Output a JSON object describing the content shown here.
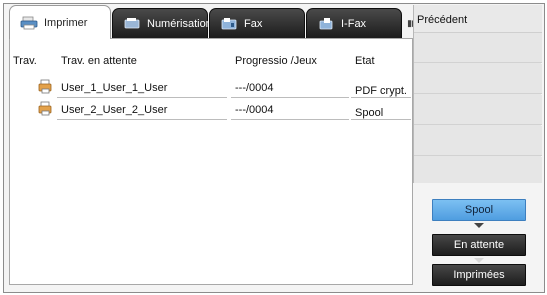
{
  "tabs": [
    {
      "label": "Imprimer",
      "icon": "printer-icon"
    },
    {
      "label": "Numérisation",
      "icon": "scanner-icon"
    },
    {
      "label": "Fax",
      "icon": "fax-icon"
    },
    {
      "label": "I-Fax",
      "icon": "internet-fax-icon"
    }
  ],
  "active_tab": "Imprimer",
  "columns": {
    "trav": "Trav.",
    "attente": "Trav. en attente",
    "progress": "Progressio /Jeux",
    "state": "Etat"
  },
  "jobs": [
    {
      "name": "User_1_User_1_User",
      "progress": "---/0004",
      "state": "PDF crypt.",
      "icon": "print-job-icon"
    },
    {
      "name": "User_2_User_2_User",
      "progress": "---/0004",
      "state": "Spool",
      "icon": "print-job-icon"
    }
  ],
  "side": {
    "prev_label": "Précédent"
  },
  "queue_buttons": {
    "spool": "Spool",
    "en_attente": "En attente",
    "imprimees": "Imprimées"
  },
  "colors": {
    "accent_blue": "#5fa9e8",
    "dark_button": "#2a2a2a"
  }
}
